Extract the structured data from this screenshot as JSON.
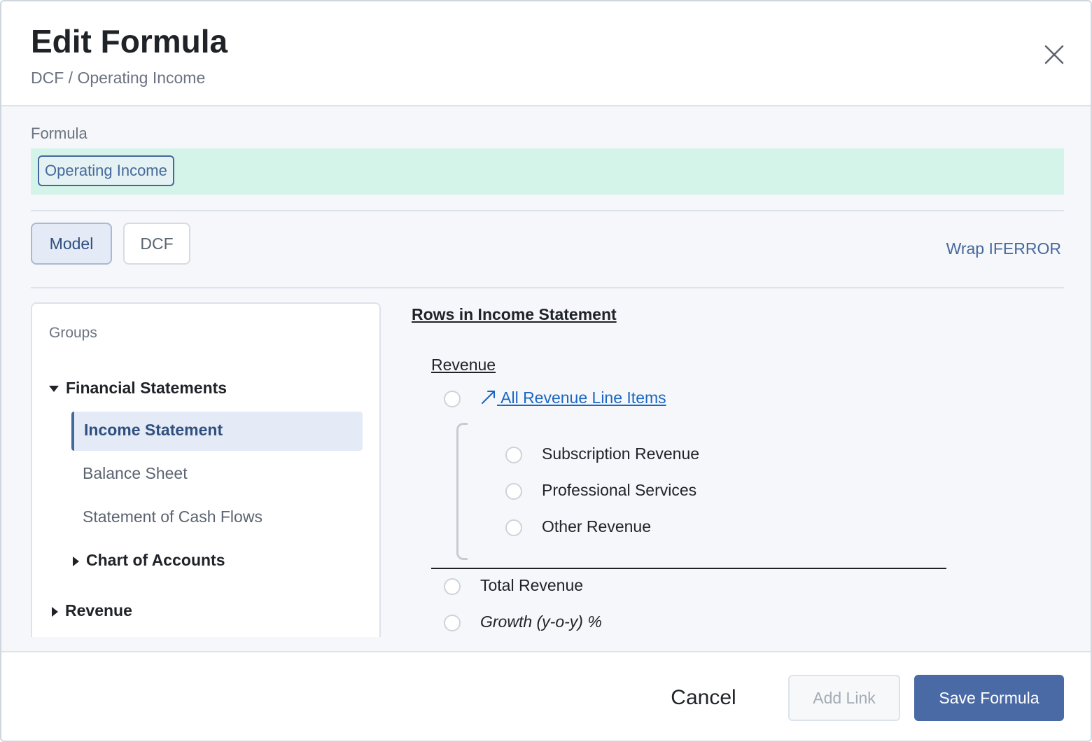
{
  "header": {
    "title": "Edit Formula",
    "breadcrumb": "DCF / Operating Income",
    "close_icon": "close-icon"
  },
  "formula": {
    "label": "Formula",
    "chip": "Operating Income"
  },
  "source_tabs": [
    {
      "label": "Model",
      "selected": true
    },
    {
      "label": "DCF",
      "selected": false
    }
  ],
  "wrap_iferror": "Wrap IFERROR",
  "groups": {
    "title": "Groups",
    "financial_statements": "Financial Statements",
    "income_statement": "Income Statement",
    "balance_sheet": "Balance Sheet",
    "cash_flows": "Statement of Cash Flows",
    "chart_of_accounts": "Chart of Accounts",
    "revenue": "Revenue"
  },
  "rows": {
    "title": "Rows in Income Statement",
    "section": "Revenue",
    "all_link_icon": "arrow-up-right-icon",
    "all_link": "All Revenue Line Items",
    "items": [
      "Subscription Revenue",
      "Professional Services",
      "Other Revenue"
    ],
    "total": "Total Revenue",
    "growth": "Growth (y-o-y) %"
  },
  "footer": {
    "cancel": "Cancel",
    "add_link": "Add Link",
    "save": "Save Formula"
  },
  "colors": {
    "accent": "#4a6aa5",
    "formula_bg": "#d4f4ea",
    "link": "#1a67c2"
  }
}
